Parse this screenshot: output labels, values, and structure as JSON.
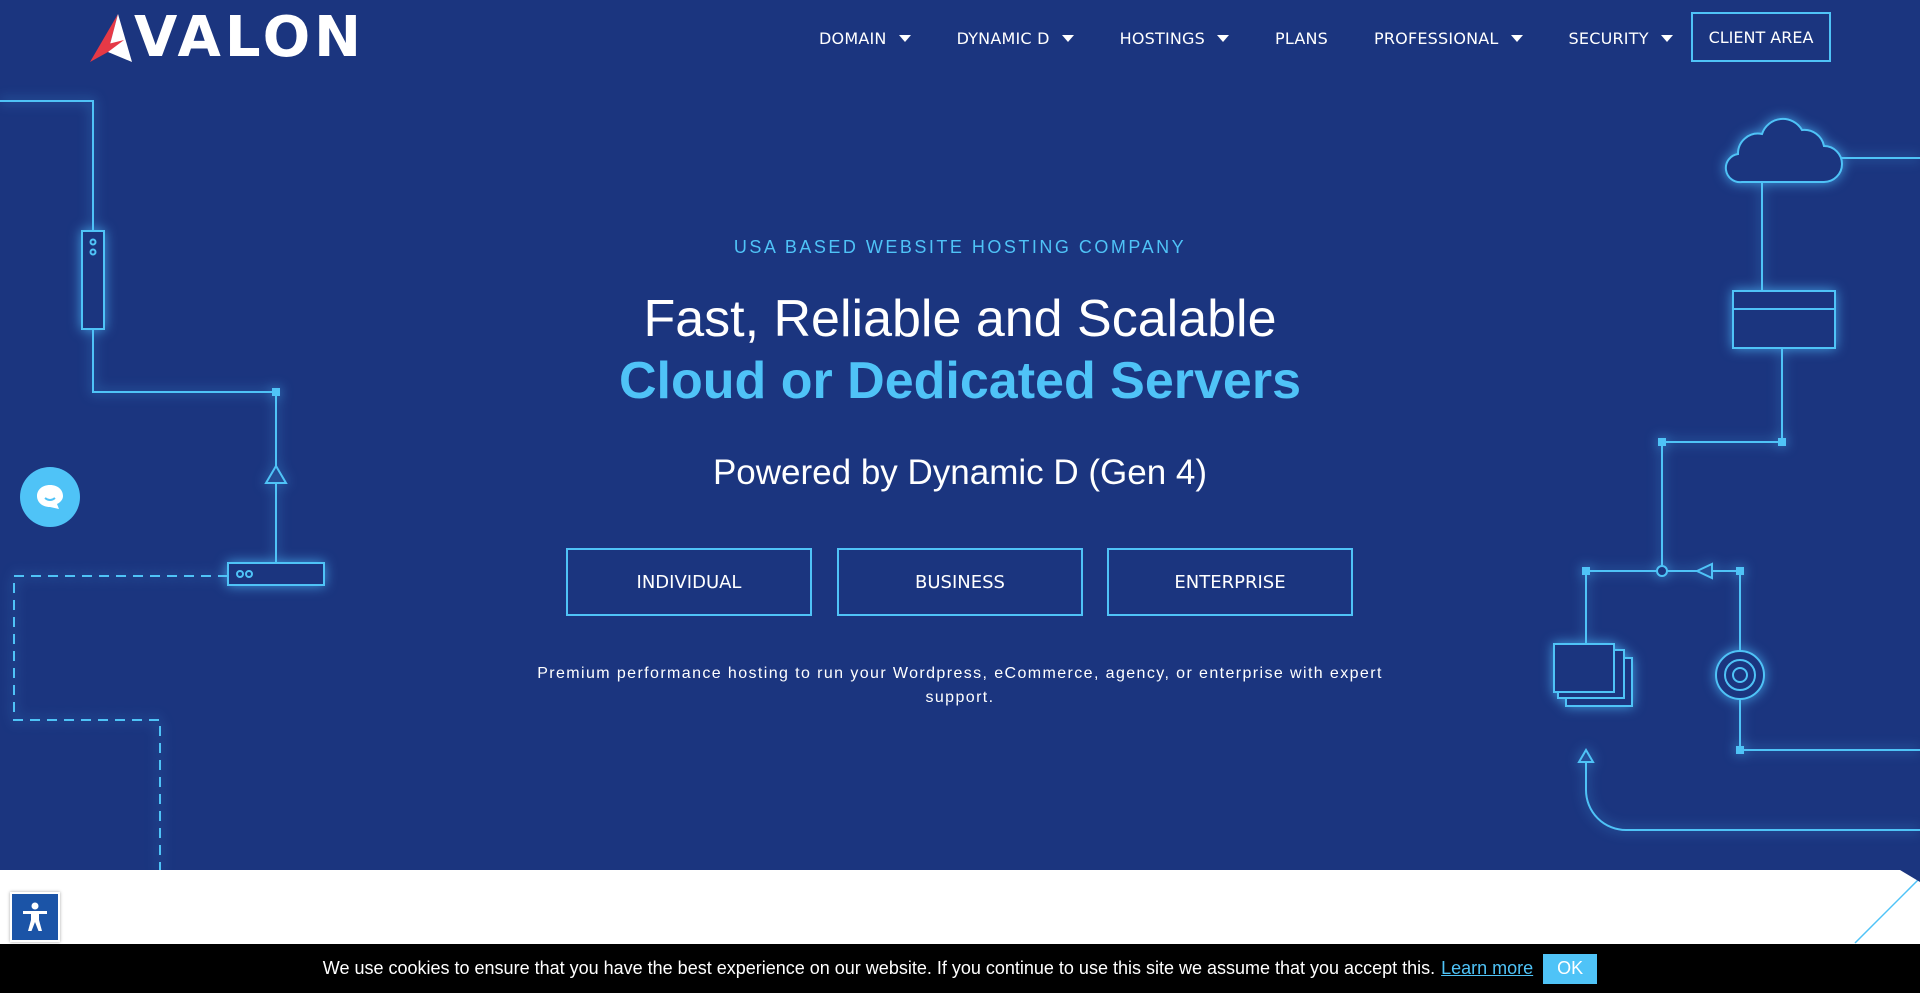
{
  "brand": {
    "name": "VALON",
    "accent": "#e63946"
  },
  "nav": {
    "items": [
      {
        "label": "DOMAIN",
        "dropdown": true
      },
      {
        "label": "DYNAMIC D",
        "dropdown": true
      },
      {
        "label": "HOSTINGS",
        "dropdown": true
      },
      {
        "label": "PLANS",
        "dropdown": false
      },
      {
        "label": "PROFESSIONAL",
        "dropdown": true
      },
      {
        "label": "SECURITY",
        "dropdown": true
      }
    ],
    "client_area": "CLIENT AREA"
  },
  "hero": {
    "eyebrow": "USA BASED WEBSITE HOSTING COMPANY",
    "title_line1": "Fast, Reliable and Scalable",
    "title_line2": "Cloud or Dedicated Servers",
    "subtitle": "Powered by Dynamic D (Gen 4)",
    "buttons": [
      "INDIVIDUAL",
      "BUSINESS",
      "ENTERPRISE"
    ],
    "description": "Premium performance hosting to run your Wordpress, eCommerce, agency, or enterprise with expert support."
  },
  "cookie": {
    "text": "We use cookies to ensure that you have the best experience on our website. If you continue to use this site we assume that you accept this.",
    "learn_more": "Learn more",
    "ok": "OK"
  },
  "icons": {
    "chat": "chat-bubble-icon",
    "accessibility": "accessibility-icon",
    "caret": "caret-down-icon"
  },
  "colors": {
    "background": "#1b357f",
    "accent": "#4fc3f7",
    "cookie_bar": "#000000"
  }
}
